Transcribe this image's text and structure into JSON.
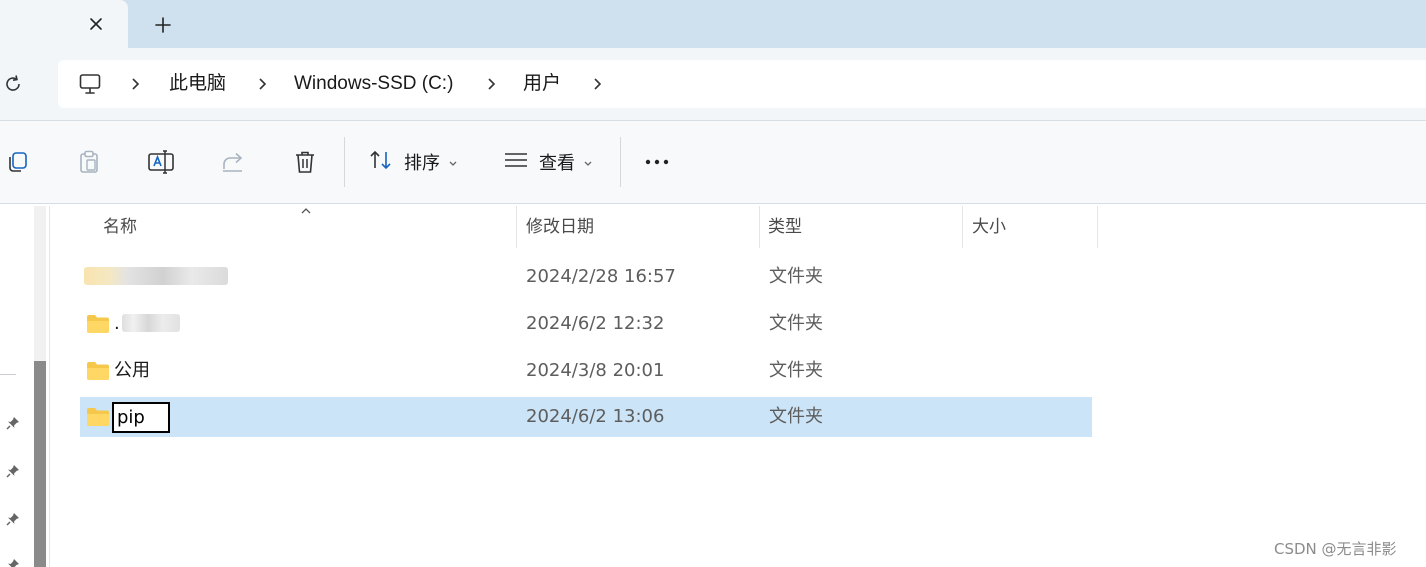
{
  "tab": {
    "close_icon": "close-icon",
    "new_tab_icon": "plus-icon"
  },
  "address": {
    "refresh_icon": "refresh-icon",
    "crumbs": [
      "此电脑",
      "Windows-SSD (C:)",
      "用户"
    ]
  },
  "toolbar": {
    "sort_label": "排序",
    "view_label": "查看",
    "more_label": "···"
  },
  "columns": {
    "name": "名称",
    "modified": "修改日期",
    "type": "类型",
    "size": "大小"
  },
  "rows": [
    {
      "name": "",
      "date": "2024/2/28 16:57",
      "type": "文件夹"
    },
    {
      "name": ".",
      "date": "2024/6/2 12:32",
      "type": "文件夹"
    },
    {
      "name": "公用",
      "date": "2024/3/8 20:01",
      "type": "文件夹"
    },
    {
      "name": "pip",
      "date": "2024/6/2 13:06",
      "type": "文件夹"
    }
  ],
  "watermark": "CSDN @无言非影",
  "colors": {
    "selection": "#cce4f7",
    "folder": "#f5c84c",
    "tabstrip": "#cfe0ee"
  }
}
